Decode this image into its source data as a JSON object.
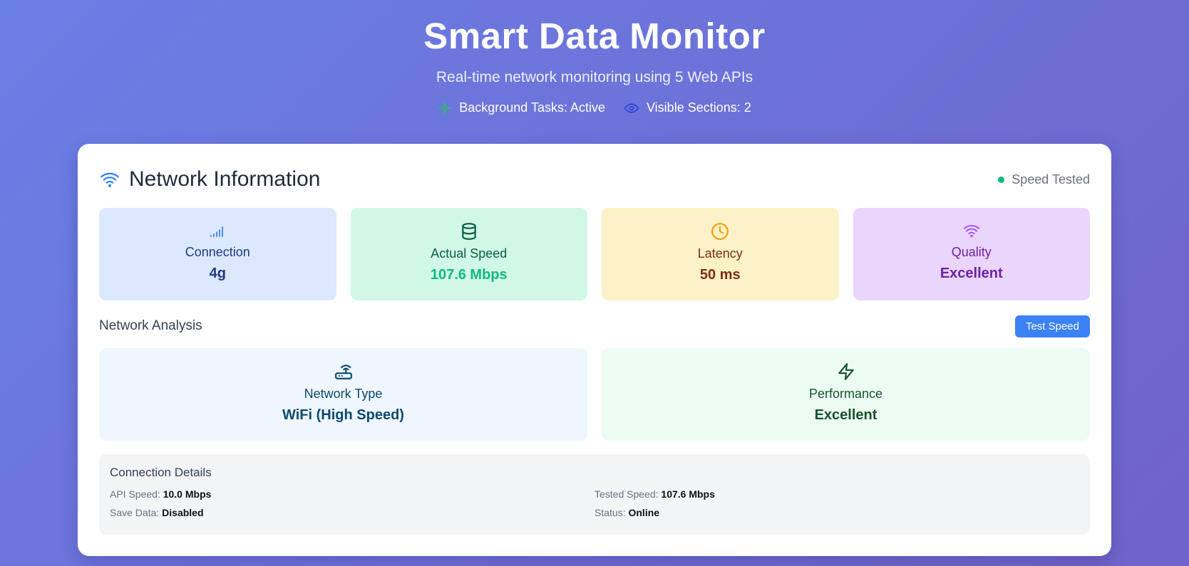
{
  "header": {
    "title": "Smart Data Monitor",
    "subtitle": "Real-time network monitoring using 5 Web APIs",
    "background_tasks": "Background Tasks: Active",
    "visible_sections": "Visible Sections: 2"
  },
  "network": {
    "title": "Network Information",
    "status": "Speed Tested",
    "stats": [
      {
        "label": "Connection",
        "value": "4g",
        "icon": "signal-bars-icon"
      },
      {
        "label": "Actual Speed",
        "value": "107.6 Mbps",
        "icon": "database-icon"
      },
      {
        "label": "Latency",
        "value": "50 ms",
        "icon": "clock-icon"
      },
      {
        "label": "Quality",
        "value": "Excellent",
        "icon": "wifi-icon"
      }
    ]
  },
  "analysis": {
    "title": "Network Analysis",
    "button": "Test Speed",
    "items": [
      {
        "label": "Network Type",
        "value": "WiFi (High Speed)",
        "icon": "router-icon"
      },
      {
        "label": "Performance",
        "value": "Excellent",
        "icon": "lightning-icon"
      }
    ]
  },
  "details": {
    "title": "Connection Details",
    "rows": [
      {
        "key": "API Speed:",
        "value": "10.0 Mbps"
      },
      {
        "key": "Tested Speed:",
        "value": "107.6 Mbps"
      },
      {
        "key": "Save Data:",
        "value": "Disabled"
      },
      {
        "key": "Status:",
        "value": "Online"
      }
    ]
  },
  "colors": {
    "accent": "#3b82f6",
    "success": "#10b981"
  }
}
